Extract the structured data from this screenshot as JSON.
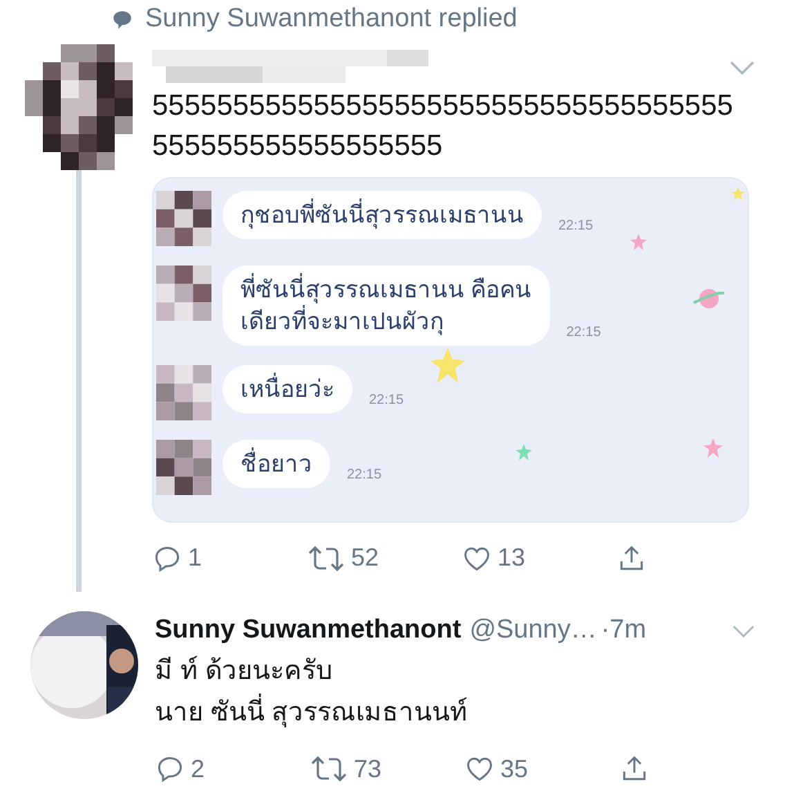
{
  "notice": {
    "text": "Sunny Suwanmethanont replied"
  },
  "tweet": {
    "text": "555555555555555555555555555555555555555555555555555555",
    "chat": [
      {
        "text": "กุชอบพี่ซันนี่สุวรรณเมธานน",
        "time": "22:15"
      },
      {
        "text": "พี่ซันนี่สุวรรณเมธานน คือคน\nเดียวที่จะมาเปนผัวกุ",
        "time": "22:15"
      },
      {
        "text": "เหนื่อยว่ะ",
        "time": "22:15"
      },
      {
        "text": "ชื่อยาว",
        "time": "22:15"
      }
    ],
    "actions": {
      "replies": "1",
      "retweets": "52",
      "likes": "13"
    }
  },
  "reply": {
    "name": "Sunny Suwanmethanont",
    "handle": "@Sunny…",
    "time": "·7m",
    "lines": [
      "มี ท์ ด้วยนะครับ",
      "นาย ซันนี่ สุวรรณเมธานนท์"
    ],
    "actions": {
      "replies": "2",
      "retweets": "73",
      "likes": "35"
    }
  }
}
